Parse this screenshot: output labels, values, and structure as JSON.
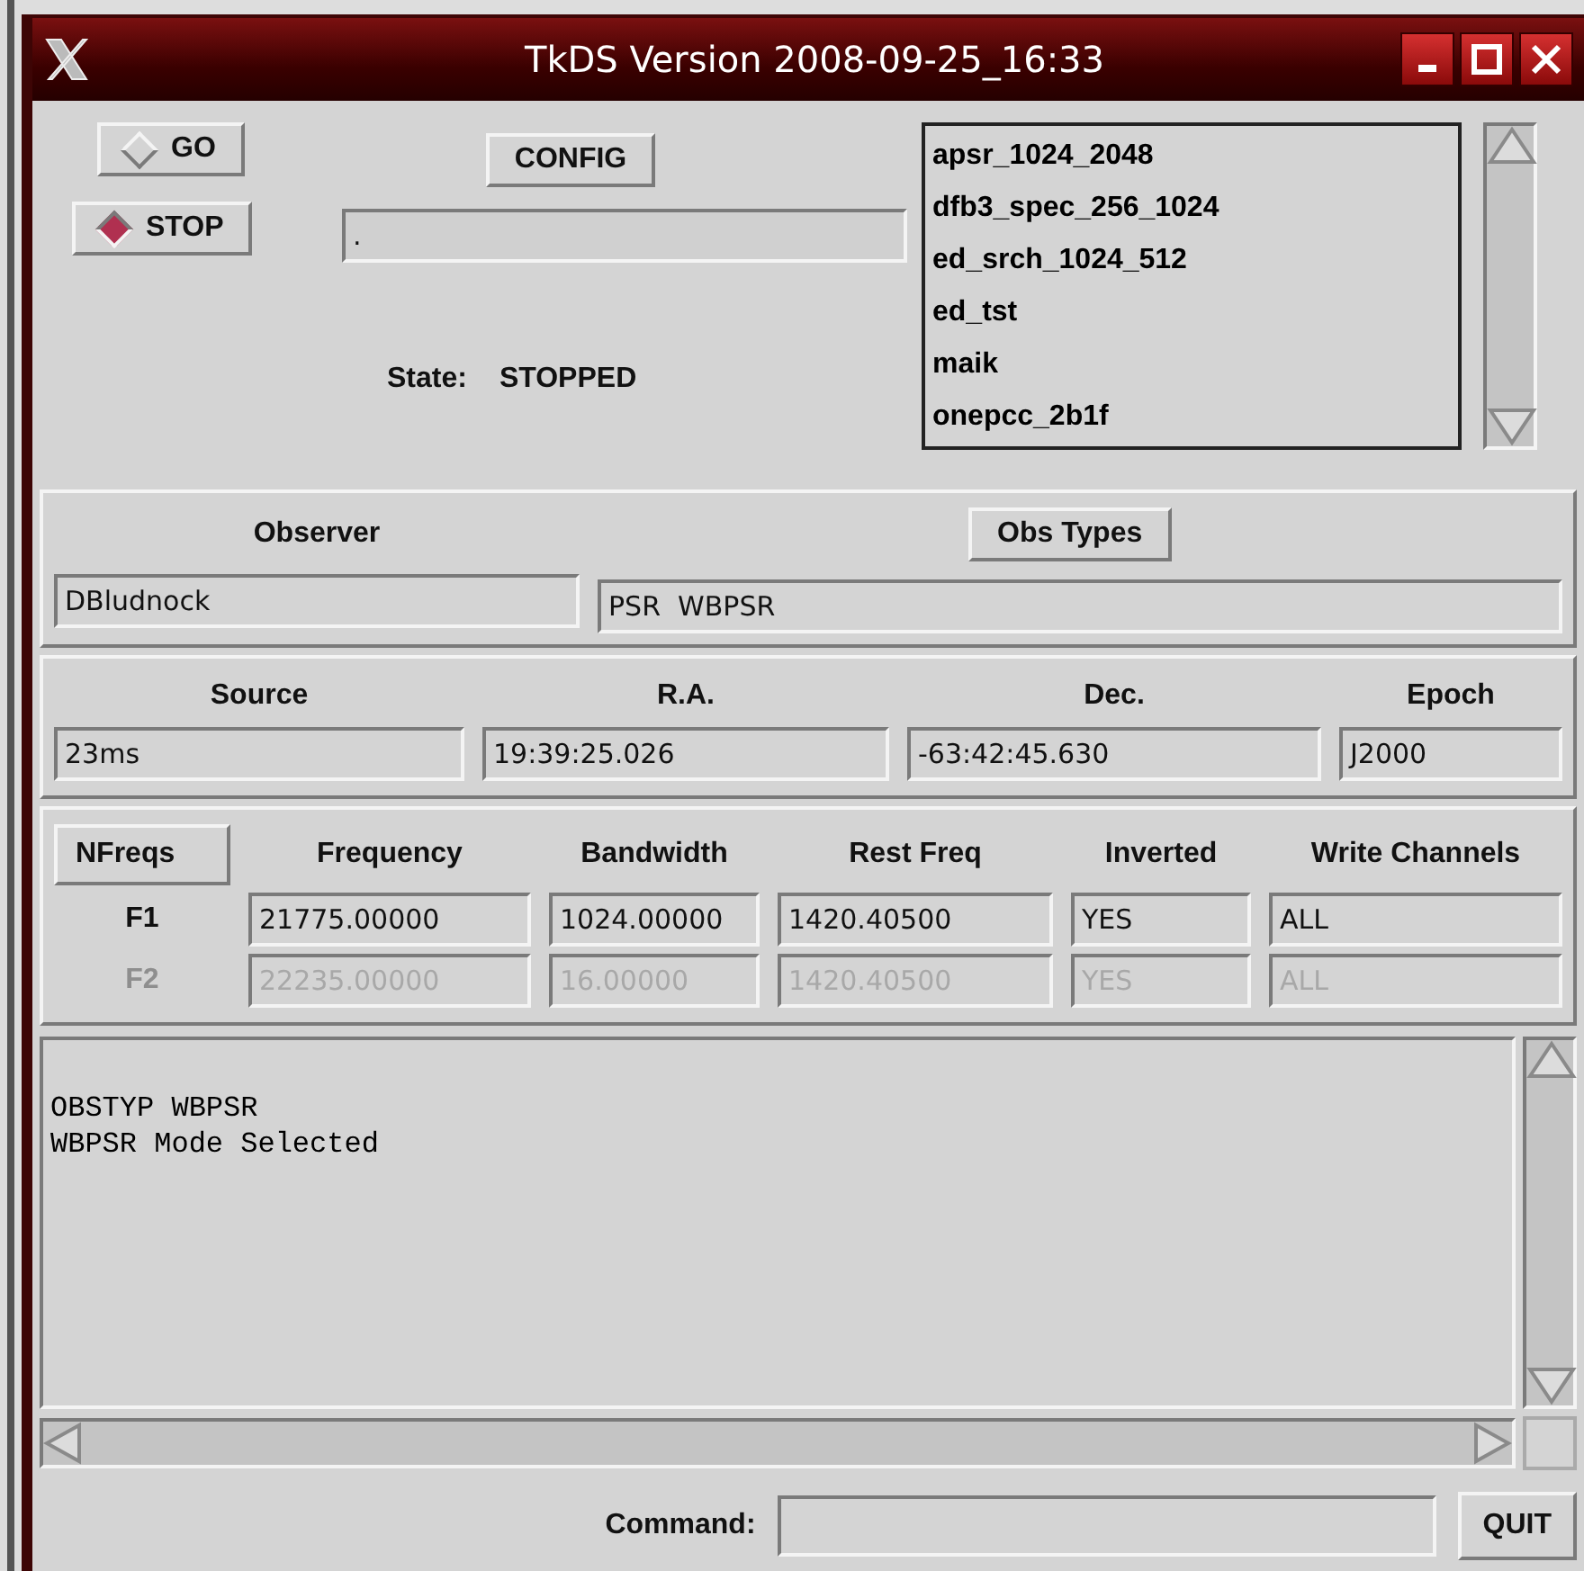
{
  "window": {
    "title": "TkDS  Version 2008-09-25_16:33"
  },
  "run_controls": [
    {
      "label": "GO",
      "selected": false
    },
    {
      "label": "STOP",
      "selected": true
    }
  ],
  "config_button": "CONFIG",
  "status_field": {
    "value": "."
  },
  "state": {
    "label": "State:",
    "value": "STOPPED"
  },
  "config_list": {
    "items": [
      "apsr_1024_2048",
      "dfb3_spec_256_1024",
      "ed_srch_1024_512",
      "ed_tst",
      "maik",
      "onepcc_2b1f"
    ]
  },
  "observer": {
    "label": "Observer",
    "value": "DBludnock"
  },
  "obs_types": {
    "button": "Obs Types",
    "value": "PSR  WBPSR"
  },
  "source_fields": [
    {
      "label": "Source",
      "value": "23ms"
    },
    {
      "label": "R.A.",
      "value": "19:39:25.026"
    },
    {
      "label": "Dec.",
      "value": "-63:42:45.630"
    },
    {
      "label": "Epoch",
      "value": "J2000"
    }
  ],
  "nfreqs_button": "NFreqs",
  "freq_columns": [
    "Frequency",
    "Bandwidth",
    "Rest Freq",
    "Inverted",
    "Write Channels"
  ],
  "freq_rows": [
    {
      "label": "F1",
      "disabled": false,
      "values": [
        "21775.00000",
        "1024.00000",
        "1420.40500",
        "YES",
        "ALL"
      ]
    },
    {
      "label": "F2",
      "disabled": true,
      "values": [
        "22235.00000",
        "16.00000",
        "1420.40500",
        "YES",
        "ALL"
      ]
    }
  ],
  "log": {
    "lines": [
      "OBSTYP WBPSR",
      "WBPSR Mode Selected"
    ]
  },
  "command": {
    "label": "Command:"
  },
  "quit_button": "QUIT"
}
